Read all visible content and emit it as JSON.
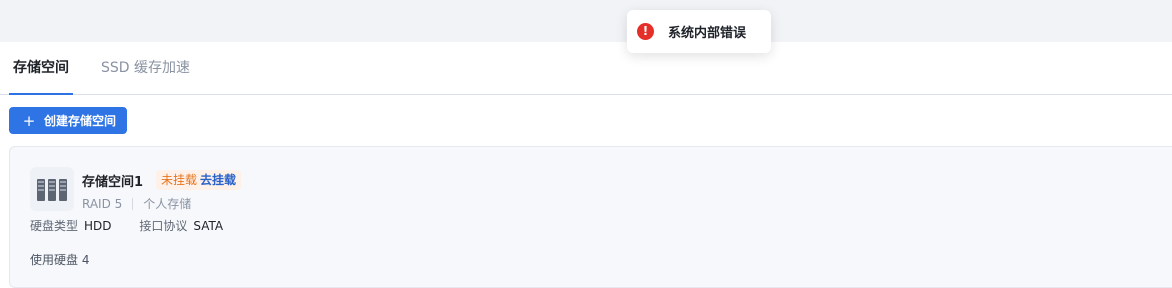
{
  "tabs": [
    {
      "label": "存储空间",
      "active": true
    },
    {
      "label": "SSD 缓存加速",
      "active": false
    }
  ],
  "toolbar": {
    "create_label": "创建存储空间",
    "create_icon": "plus-icon"
  },
  "storage_pool": {
    "icon": "disk-array-icon",
    "name": "存储空间1",
    "status": "未挂载",
    "action_label": "去挂载",
    "raid": "RAID 5",
    "usage": "个人存储",
    "disk_type_label": "硬盘类型",
    "disk_type_value": "HDD",
    "interface_label": "接口协议",
    "interface_value": "SATA",
    "used_disks": "使用硬盘 4"
  },
  "toast": {
    "icon": "error-icon",
    "message": "系统内部错误"
  },
  "colors": {
    "accent": "#2e74e5",
    "error": "#e5302a",
    "warning": "#e8751d",
    "link": "#2a62c9"
  }
}
